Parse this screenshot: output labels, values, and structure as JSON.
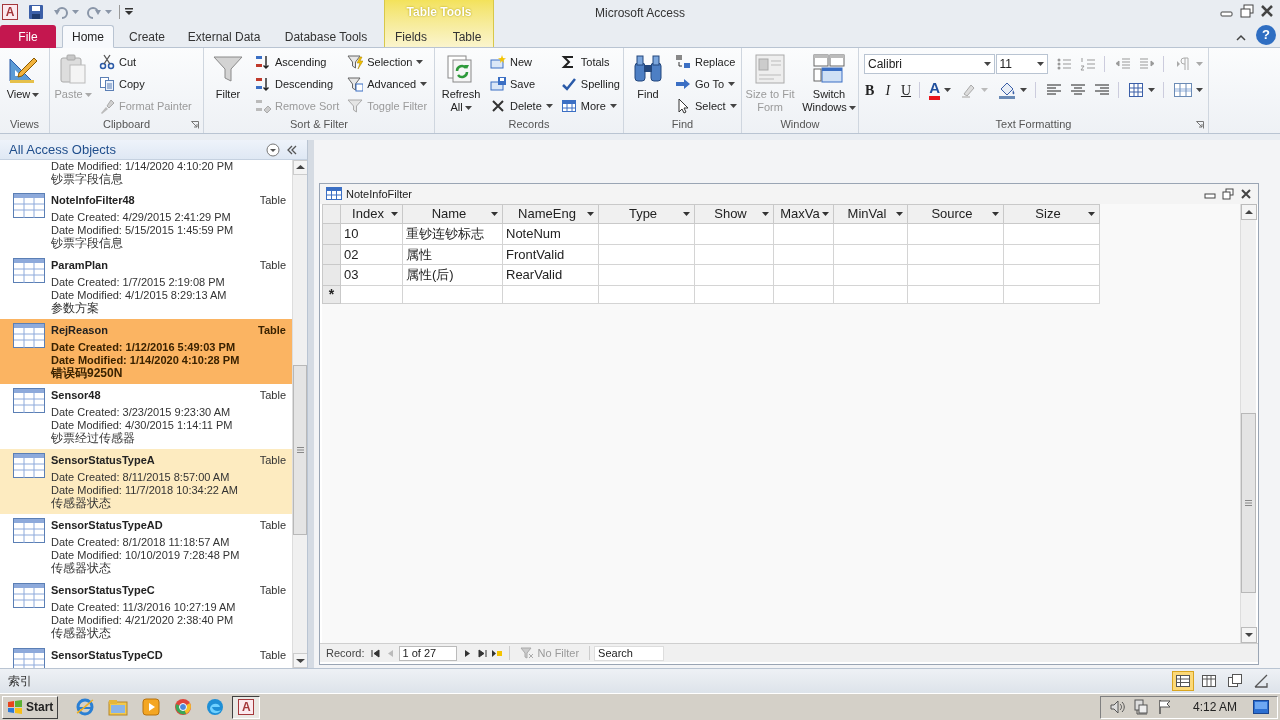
{
  "title_bar": {
    "app_icon": "A",
    "title": "Microsoft Access",
    "context_group": "Table Tools",
    "help": "?"
  },
  "ribbon_tabs": [
    {
      "label": "File",
      "kind": "file",
      "selected": false
    },
    {
      "label": "Home",
      "kind": "tab",
      "selected": true
    },
    {
      "label": "Create",
      "kind": "tab",
      "selected": false
    },
    {
      "label": "External Data",
      "kind": "tab",
      "selected": false
    },
    {
      "label": "Database Tools",
      "kind": "tab",
      "selected": false
    },
    {
      "label": "Fields",
      "kind": "context",
      "selected": false
    },
    {
      "label": "Table",
      "kind": "context",
      "selected": false
    }
  ],
  "ribbon_groups": [
    {
      "label": "Views",
      "dialog_launcher": false,
      "columns": [
        [
          {
            "label": "View",
            "kind": "large",
            "disabled": false,
            "dropdown": true
          }
        ]
      ]
    },
    {
      "label": "Clipboard",
      "dialog_launcher": true,
      "columns": [
        [
          {
            "label": "Paste",
            "kind": "large",
            "disabled": true,
            "dropdown": true
          }
        ],
        [
          {
            "label": "Cut",
            "kind": "small",
            "disabled": false,
            "dropdown": false
          },
          {
            "label": "Copy",
            "kind": "small",
            "disabled": false,
            "dropdown": false
          },
          {
            "label": "Format Painter",
            "kind": "small",
            "disabled": true,
            "dropdown": false
          }
        ]
      ]
    },
    {
      "label": "Sort & Filter",
      "dialog_launcher": false,
      "columns": [
        [
          {
            "label": "Filter",
            "kind": "large",
            "disabled": false,
            "dropdown": false
          }
        ],
        [
          {
            "label": "Ascending",
            "kind": "small",
            "disabled": false,
            "dropdown": false
          },
          {
            "label": "Descending",
            "kind": "small",
            "disabled": false,
            "dropdown": false
          },
          {
            "label": "Remove Sort",
            "kind": "small",
            "disabled": true,
            "dropdown": false
          }
        ],
        [
          {
            "label": "Selection",
            "kind": "small",
            "disabled": false,
            "dropdown": true
          },
          {
            "label": "Advanced",
            "kind": "small",
            "disabled": false,
            "dropdown": true
          },
          {
            "label": "Toggle Filter",
            "kind": "small",
            "disabled": true,
            "dropdown": false
          }
        ]
      ]
    },
    {
      "label": "Records",
      "dialog_launcher": false,
      "columns": [
        [
          {
            "label": "Refresh All",
            "kind": "large",
            "disabled": false,
            "dropdown": true
          }
        ],
        [
          {
            "label": "New",
            "kind": "small",
            "disabled": false,
            "dropdown": false
          },
          {
            "label": "Save",
            "kind": "small",
            "disabled": false,
            "dropdown": false
          },
          {
            "label": "Delete",
            "kind": "small",
            "disabled": false,
            "dropdown": true
          }
        ],
        [
          {
            "label": "Totals",
            "kind": "small",
            "disabled": false,
            "dropdown": false
          },
          {
            "label": "Spelling",
            "kind": "small",
            "disabled": false,
            "dropdown": false
          },
          {
            "label": "More",
            "kind": "small",
            "disabled": false,
            "dropdown": true
          }
        ]
      ]
    },
    {
      "label": "Find",
      "dialog_launcher": false,
      "columns": [
        [
          {
            "label": "Find",
            "kind": "large",
            "disabled": false,
            "dropdown": false
          }
        ],
        [
          {
            "label": "Replace",
            "kind": "small",
            "disabled": false,
            "dropdown": false
          },
          {
            "label": "Go To",
            "kind": "small",
            "disabled": false,
            "dropdown": true
          },
          {
            "label": "Select",
            "kind": "small",
            "disabled": false,
            "dropdown": true
          }
        ]
      ]
    },
    {
      "label": "Window",
      "dialog_launcher": false,
      "columns": [
        [
          {
            "label": "Size to Fit Form",
            "kind": "large",
            "disabled": true,
            "dropdown": false
          }
        ],
        [
          {
            "label": "Switch Windows",
            "kind": "large",
            "disabled": false,
            "dropdown": true
          }
        ]
      ]
    }
  ],
  "text_formatting": {
    "label": "Text Formatting",
    "font": "Calibri",
    "font_size": "11",
    "bold": "B",
    "italic": "I",
    "underline": "U",
    "font_color": "A"
  },
  "navigation_pane": {
    "title": "All Access Objects",
    "items": [
      {
        "modified": "Date Modified: 1/14/2020 4:10:20 PM",
        "description": "钞票字段信息",
        "selected": false,
        "hovered": false
      },
      {
        "name": "NoteInfoFilter48",
        "type": "Table",
        "created": "Date Created: 4/29/2015 2:41:29 PM",
        "modified": "Date Modified: 5/15/2015 1:45:59 PM",
        "description": "钞票字段信息",
        "selected": false,
        "hovered": false
      },
      {
        "name": "ParamPlan",
        "type": "Table",
        "created": "Date Created: 1/7/2015 2:19:08 PM",
        "modified": "Date Modified: 4/1/2015 8:29:13 AM",
        "description": "参数方案",
        "selected": false,
        "hovered": false
      },
      {
        "name": "RejReason",
        "type": "Table",
        "created": "Date Created: 1/12/2016 5:49:03 PM",
        "modified": "Date Modified: 1/14/2020 4:10:28 PM",
        "description": "错误码9250N",
        "selected": true,
        "hovered": false
      },
      {
        "name": "Sensor48",
        "type": "Table",
        "created": "Date Created: 3/23/2015 9:23:30 AM",
        "modified": "Date Modified: 4/30/2015 1:14:11 PM",
        "description": "钞票经过传感器",
        "selected": false,
        "hovered": false
      },
      {
        "name": "SensorStatusTypeA",
        "type": "Table",
        "created": "Date Created: 8/11/2015 8:57:00 AM",
        "modified": "Date Modified: 11/7/2018 10:34:22 AM",
        "description": "传感器状态",
        "selected": false,
        "hovered": true
      },
      {
        "name": "SensorStatusTypeAD",
        "type": "Table",
        "created": "Date Created: 8/1/2018 11:18:57 AM",
        "modified": "Date Modified: 10/10/2019 7:28:48 PM",
        "description": "传感器状态",
        "selected": false,
        "hovered": false
      },
      {
        "name": "SensorStatusTypeC",
        "type": "Table",
        "created": "Date Created: 11/3/2016 10:27:19 AM",
        "modified": "Date Modified: 4/21/2020 2:38:40 PM",
        "description": "传感器状态",
        "selected": false,
        "hovered": false
      },
      {
        "name": "SensorStatusTypeCD",
        "type": "Table",
        "selected": false,
        "hovered": false
      }
    ]
  },
  "document": {
    "title": "NoteInfoFilter",
    "columns": [
      "Index",
      "Name",
      "NameEng",
      "Type",
      "Show",
      "MaxVa",
      "MinVal",
      "Source",
      "Size"
    ],
    "rows": [
      [
        "10",
        "重钞连钞标志",
        "NoteNum"
      ],
      [
        "02",
        "属性",
        "FrontValid"
      ],
      [
        "03",
        "属性(后)",
        "RearValid"
      ]
    ],
    "new_record_marker": "*",
    "record_label": "Record:",
    "record_position": "1 of 27",
    "filter_status": "No Filter",
    "search_placeholder": "Search"
  },
  "status_bar": {
    "text": "索引",
    "views": [
      {
        "selected": true
      },
      {
        "selected": false
      },
      {
        "selected": false
      },
      {
        "selected": false
      }
    ]
  },
  "taskbar": {
    "start": "Start",
    "app_button": "A",
    "clock": "4:12 AM"
  }
}
